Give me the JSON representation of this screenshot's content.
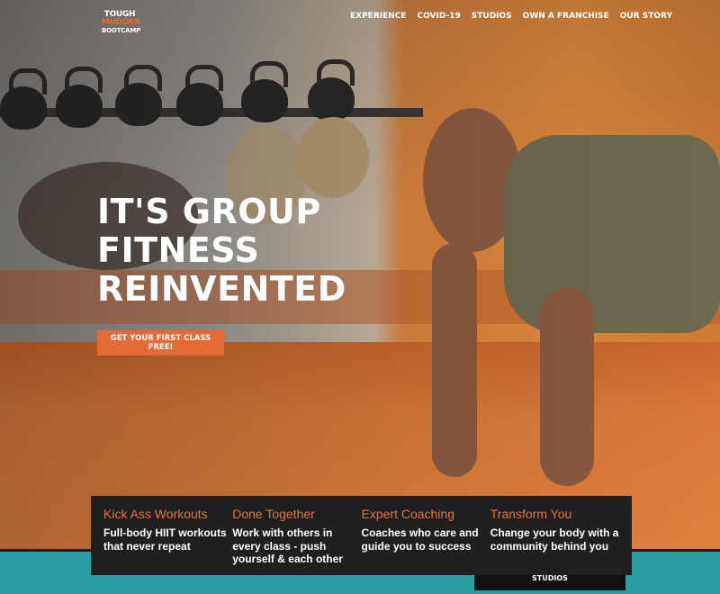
{
  "brand": {
    "logo_line1": "TOUGH",
    "logo_line2": "MUDDER",
    "logo_line3": "BOOTCAMP",
    "accent_color": "#e36a34",
    "teal_color": "#2b9ea3"
  },
  "nav": {
    "items": [
      {
        "label": "EXPERIENCE"
      },
      {
        "label": "COVID-19"
      },
      {
        "label": "STUDIOS"
      },
      {
        "label": "OWN A FRANCHISE"
      },
      {
        "label": "OUR STORY"
      }
    ]
  },
  "hero": {
    "headline_line1": "IT'S GROUP",
    "headline_line2": "FITNESS",
    "headline_line3": "REINVENTED",
    "cta_label": "GET YOUR FIRST CLASS FREE!"
  },
  "features": [
    {
      "title": "Kick Ass Workouts",
      "text": "Full-body HIIT workouts that never repeat"
    },
    {
      "title": "Done Together",
      "text": "Work with others in every class - push yourself & each other"
    },
    {
      "title": "Expert Coaching",
      "text": "Coaches who care and guide you to success"
    },
    {
      "title": "Transform You",
      "text": "Change your body with a community behind you"
    }
  ],
  "secondary_cta": {
    "label": "LEARN ABOUT OUR VOLUPIT STUDIOS"
  }
}
